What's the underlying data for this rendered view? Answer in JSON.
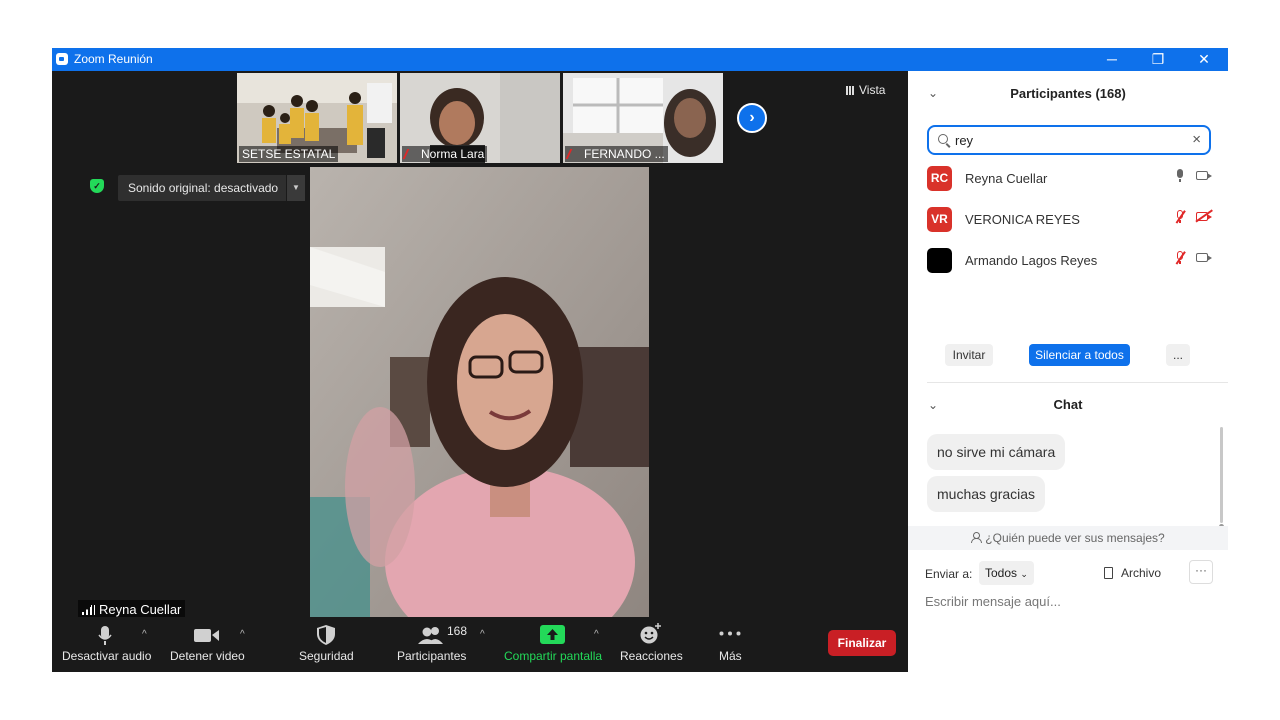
{
  "window": {
    "title": "Zoom Reunión",
    "controls": {
      "minimize": "─",
      "restore": "❐",
      "close": "✕"
    }
  },
  "stage": {
    "view_label": "Vista",
    "thumbnails": [
      {
        "label": "SETSE ESTATAL",
        "muted": false
      },
      {
        "label": "Norma Lara",
        "muted": true
      },
      {
        "label": "FERNANDO ...",
        "muted": true
      }
    ],
    "next_page_icon": "chevron-right-icon",
    "original_sound": "Sonido original: desactivado",
    "active_speaker": "Reyna Cuellar"
  },
  "toolbar": {
    "audio": "Desactivar audio",
    "video": "Detener video",
    "security": "Seguridad",
    "participants": "Participantes",
    "participants_count": "168",
    "share": "Compartir pantalla",
    "reactions": "Reacciones",
    "more": "Más",
    "end": "Finalizar"
  },
  "participants_panel": {
    "title": "Participantes (168)",
    "search_value": "rey",
    "list": [
      {
        "initials": "RC",
        "name": "Reyna Cuellar",
        "avatar_color": "#d9322a",
        "mic_muted": false,
        "video_off": false
      },
      {
        "initials": "VR",
        "name": "VERONICA  REYES",
        "avatar_color": "#d9322a",
        "mic_muted": true,
        "video_off": true
      },
      {
        "initials": "",
        "name": "Armando Lagos Reyes",
        "avatar_color": "#000000",
        "mic_muted": true,
        "video_off": false
      }
    ],
    "invite": "Invitar",
    "mute_all": "Silenciar a todos",
    "more": "..."
  },
  "chat": {
    "title": "Chat",
    "messages": [
      "no sirve mi cámara",
      "muchas gracias"
    ],
    "who_can_see": "¿Quién puede ver sus mensajes?",
    "send_to_label": "Enviar a:",
    "send_to_value": "Todos",
    "file_label": "Archivo",
    "more": "···",
    "input_placeholder": "Escribir mensaje aquí..."
  },
  "colors": {
    "brand_blue": "#0e71eb",
    "end_red": "#c91f25",
    "share_green": "#23d959",
    "muted_red": "#e02828"
  }
}
